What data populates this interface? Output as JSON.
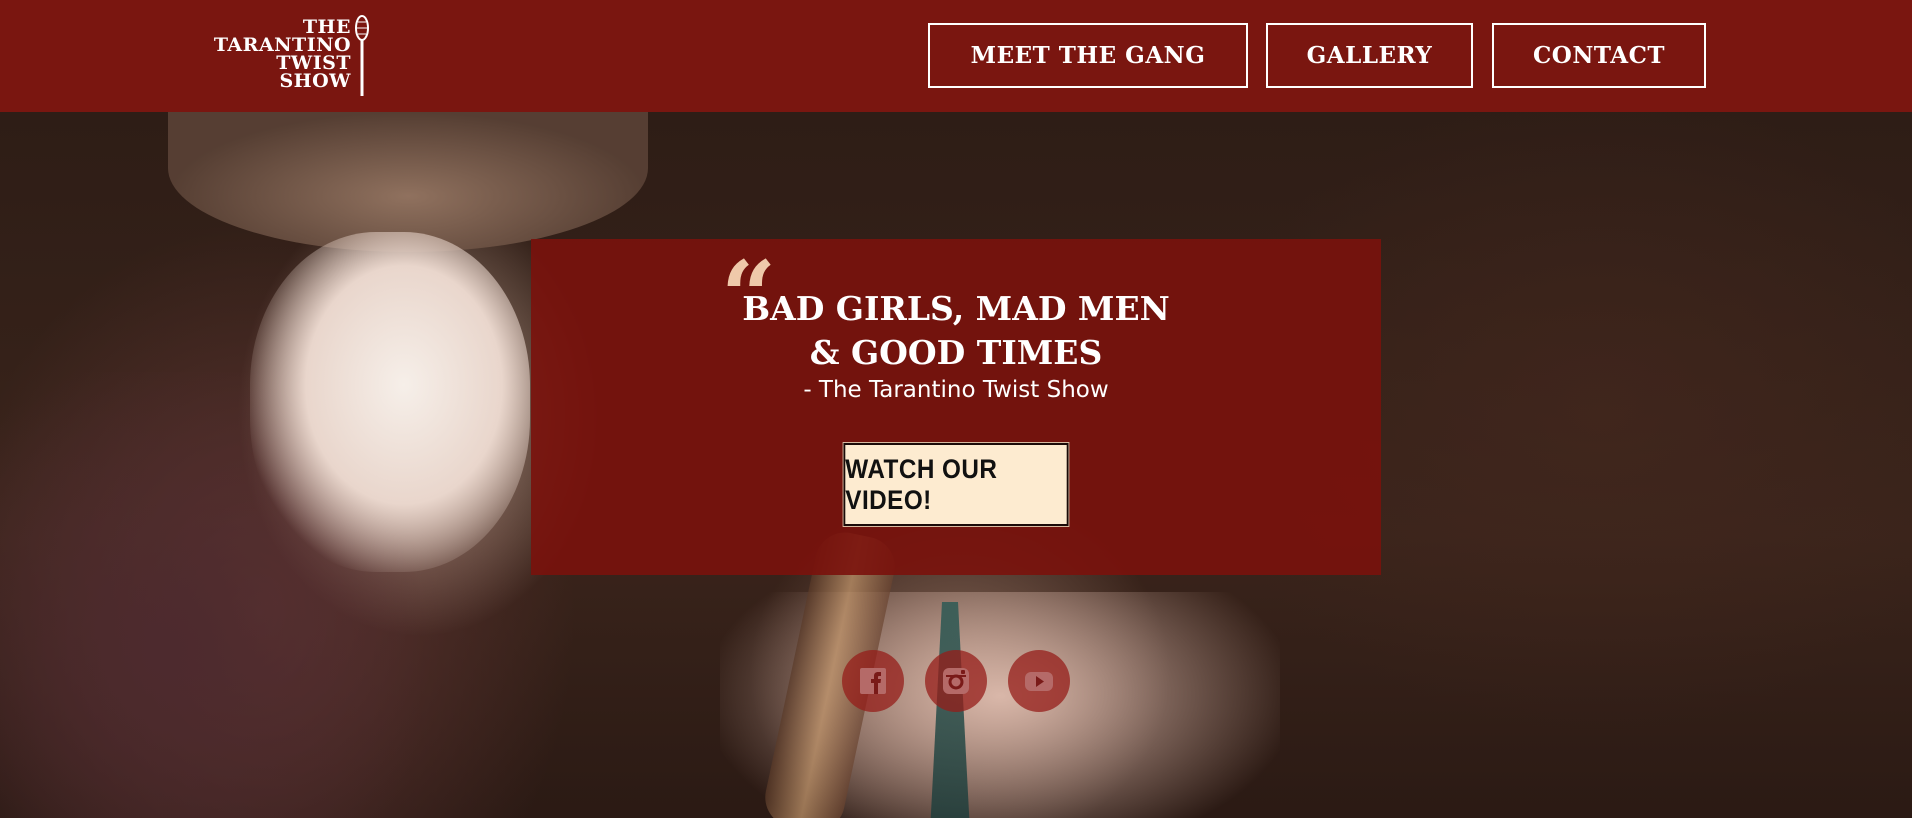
{
  "header": {
    "logo_lines": [
      "THE",
      "TARANTINO",
      "TWIST",
      "SHOW"
    ],
    "nav": [
      {
        "label": "MEET THE GANG"
      },
      {
        "label": "GALLERY"
      },
      {
        "label": "CONTACT"
      }
    ]
  },
  "hero": {
    "quote_mark": "“",
    "headline_line1": "BAD GIRLS, MAD MEN",
    "headline_line2": "& GOOD TIMES",
    "byline": "- The Tarantino Twist Show",
    "cta_label": "WATCH OUR VIDEO!"
  },
  "social": [
    {
      "icon": "facebook-icon"
    },
    {
      "icon": "instagram-icon"
    },
    {
      "icon": "youtube-icon"
    }
  ],
  "colors": {
    "header_bg": "#7a1610",
    "card_bg": "#7a120c",
    "cta_bg": "#fdebd0",
    "quote_mark": "#efc9aa"
  }
}
